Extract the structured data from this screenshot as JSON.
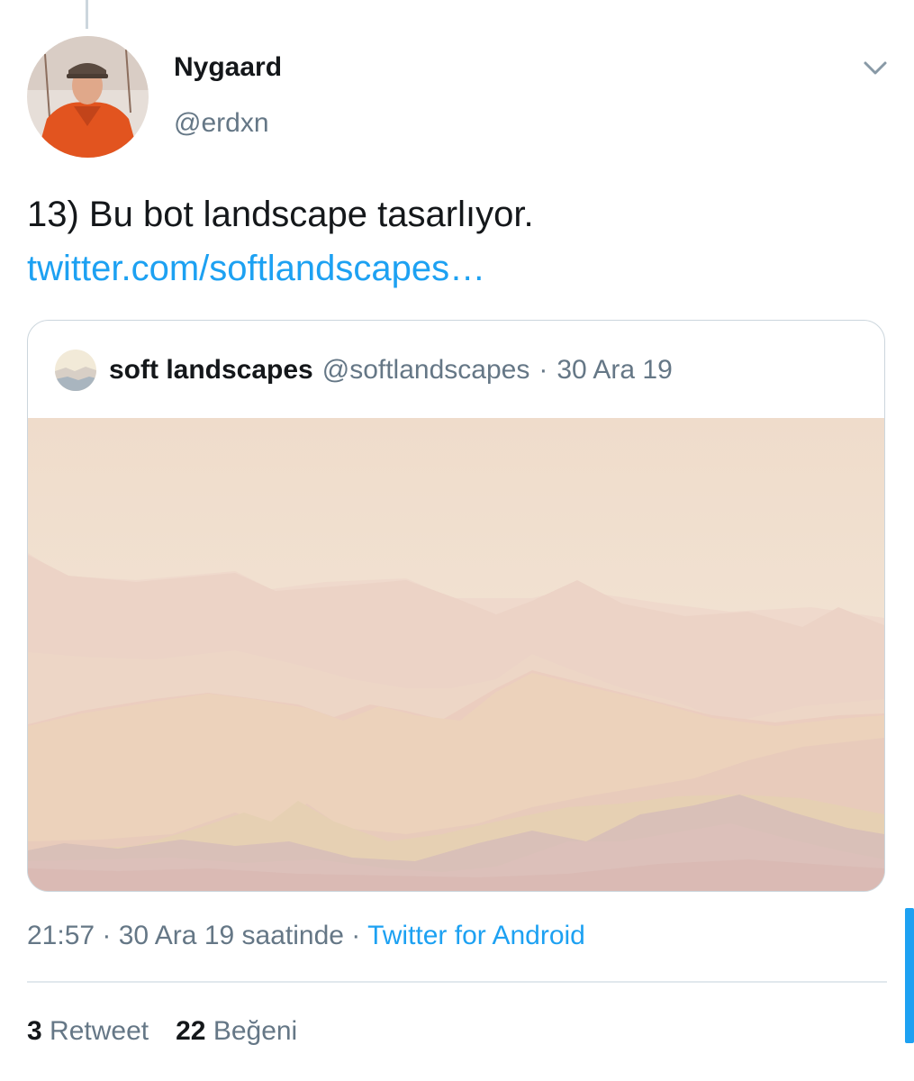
{
  "author": {
    "display_name": "Nygaard",
    "handle": "@erdxn"
  },
  "tweet": {
    "text": "13) Bu bot landscape tasarlıyor. ",
    "link_text": "twitter.com/softlandscapes…"
  },
  "quote": {
    "name": "soft landscapes",
    "handle": "@softlandscapes",
    "separator": "·",
    "date": "30 Ara 19"
  },
  "meta": {
    "time": "21:57",
    "sep1": " · ",
    "date": "30 Ara 19 saatinde",
    "sep2": " · ",
    "source": "Twitter for Android"
  },
  "stats": {
    "retweet_count": "3",
    "retweet_label": "Retweet",
    "like_count": "22",
    "like_label": "Beğeni"
  },
  "icons": {
    "menu": "chevron-down-icon"
  },
  "colors": {
    "link": "#1da1f2",
    "secondary_text": "#657786",
    "primary_text": "#14171a",
    "border": "#ccd6dd"
  }
}
